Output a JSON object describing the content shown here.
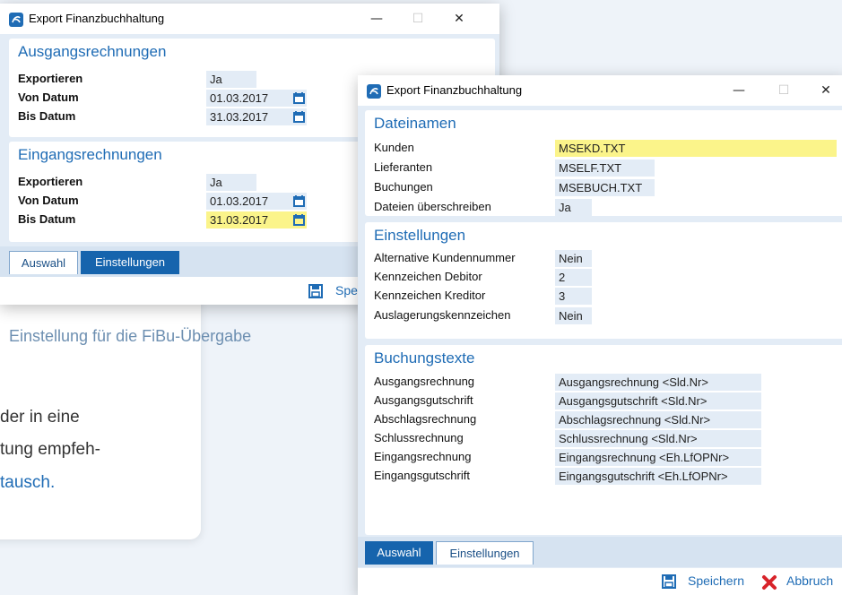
{
  "background": {
    "caption": "Einstellung für die FiBu-Übergabe",
    "text_line1": "der in eine",
    "text_line2": "tung empfeh-",
    "text_line3": "tausch."
  },
  "window_back": {
    "title": "Export Finanzbuchhaltung",
    "section_outgoing": {
      "title": "Ausgangsrechnungen",
      "rows": [
        {
          "label": "Exportieren",
          "value": "Ja"
        },
        {
          "label": "Von Datum",
          "value": "01.03.2017"
        },
        {
          "label": "Bis Datum",
          "value": "31.03.2017"
        }
      ]
    },
    "section_incoming": {
      "title": "Eingangsrechnungen",
      "rows": [
        {
          "label": "Exportieren",
          "value": "Ja"
        },
        {
          "label": "Von Datum",
          "value": "01.03.2017"
        },
        {
          "label": "Bis Datum",
          "value": "31.03.2017"
        }
      ]
    },
    "tabs": {
      "selection": "Auswahl",
      "settings": "Einstellungen"
    },
    "footer": {
      "save_partial": "Spei"
    }
  },
  "window_front": {
    "title": "Export Finanzbuchhaltung",
    "section_files": {
      "title": "Dateinamen",
      "rows": [
        {
          "label": "Kunden",
          "value": "MSEKD.TXT"
        },
        {
          "label": "Lieferanten",
          "value": "MSELF.TXT"
        },
        {
          "label": "Buchungen",
          "value": "MSEBUCH.TXT"
        },
        {
          "label": "Dateien überschreiben",
          "value": "Ja"
        }
      ]
    },
    "section_settings": {
      "title": "Einstellungen",
      "rows": [
        {
          "label": "Alternative Kundennummer",
          "value": "Nein"
        },
        {
          "label": "Kennzeichen Debitor",
          "value": "2"
        },
        {
          "label": "Kennzeichen Kreditor",
          "value": "3"
        },
        {
          "label": "Auslagerungskennzeichen",
          "value": "Nein"
        }
      ]
    },
    "section_texts": {
      "title": "Buchungstexte",
      "rows": [
        {
          "label": "Ausgangsrechnung",
          "value": "Ausgangsrechnung <Sld.Nr>"
        },
        {
          "label": "Ausgangsgutschrift",
          "value": "Ausgangsgutschrift <Sld.Nr>"
        },
        {
          "label": "Abschlagsrechnung",
          "value": "Abschlagsrechnung <Sld.Nr>"
        },
        {
          "label": "Schlussrechnung",
          "value": "Schlussrechnung <Sld.Nr>"
        },
        {
          "label": "Eingangsrechnung",
          "value": "Eingangsrechnung <Eh.LfOPNr>"
        },
        {
          "label": "Eingangsgutschrift",
          "value": "Eingangsgutschrift <Eh.LfOPNr>"
        }
      ]
    },
    "tabs": {
      "selection": "Auswahl",
      "settings": "Einstellungen"
    },
    "footer": {
      "save": "Speichern",
      "cancel": "Abbruch"
    }
  },
  "colors": {
    "accent": "#1f6cb5",
    "highlight": "#fbf48a",
    "field": "#e3ecf6",
    "tab_active": "#1664ad"
  },
  "icons": [
    "app-icon",
    "minimize-icon",
    "maximize-icon",
    "close-icon",
    "calendar-icon",
    "save-icon",
    "cancel-icon"
  ]
}
